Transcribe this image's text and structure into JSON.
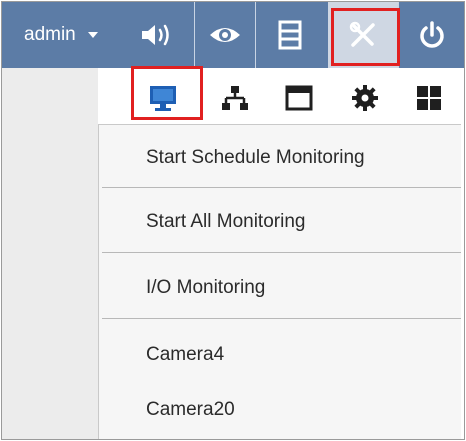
{
  "header": {
    "username": "admin",
    "icons": [
      "volume-icon",
      "eye-icon",
      "film-icon",
      "tools-icon",
      "power-icon"
    ]
  },
  "secondary_icons": [
    "monitor-icon",
    "network-icon",
    "window-icon",
    "gear-icon",
    "grid-icon"
  ],
  "menu": {
    "items": [
      {
        "label": "Start Schedule Monitoring"
      },
      {
        "label": "Start All Monitoring"
      },
      {
        "label": "I/O Monitoring"
      },
      {
        "label": "Camera4"
      },
      {
        "label": "Camera20"
      }
    ]
  },
  "colors": {
    "toolbar": "#5c7ca6",
    "toolbar_active": "#cfd7e3",
    "highlight": "#e12020",
    "icon_blue": "#1e5fb4",
    "icon_dark": "#1f1f1f"
  }
}
